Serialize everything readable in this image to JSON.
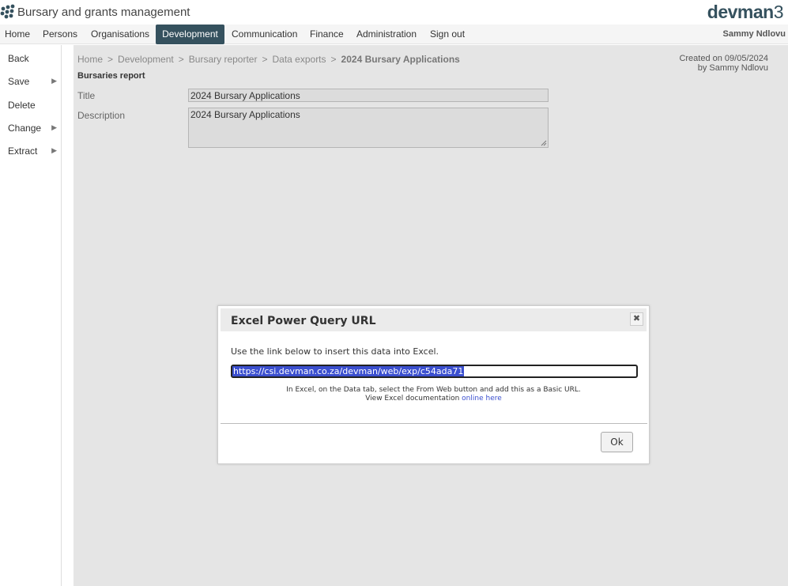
{
  "app": {
    "title": "Bursary and grants management",
    "brand_main": "devman",
    "brand_suffix": "3"
  },
  "nav": {
    "items": [
      "Home",
      "Persons",
      "Organisations",
      "Development",
      "Communication",
      "Finance",
      "Administration",
      "Sign out"
    ],
    "active": "Development",
    "user": "Sammy Ndlovu"
  },
  "sidebar": {
    "items": [
      {
        "label": "Back",
        "has_submenu": false
      },
      {
        "label": "Save",
        "has_submenu": true
      },
      {
        "label": "Delete",
        "has_submenu": false
      },
      {
        "label": "Change",
        "has_submenu": true
      },
      {
        "label": "Extract",
        "has_submenu": true
      }
    ]
  },
  "breadcrumb": {
    "items": [
      "Home",
      "Development",
      "Bursary reporter",
      "Data exports"
    ],
    "current": "2024 Bursary Applications",
    "separator": ">"
  },
  "meta": {
    "created_line1": "Created on 09/05/2024",
    "created_line2": "by Sammy Ndlovu"
  },
  "form": {
    "section_title": "Bursaries report",
    "title_label": "Title",
    "title_value": "2024 Bursary Applications",
    "description_label": "Description",
    "description_value": "2024 Bursary Applications"
  },
  "modal": {
    "title": "Excel Power Query URL",
    "close_icon": "close-icon",
    "intro": "Use the link below to insert this data into Excel.",
    "url": "https://csi.devman.co.za/devman/web/exp/c54ada71",
    "hint_line1": "In Excel, on the Data tab, select the From Web button and add this as a Basic URL.",
    "hint_line2_prefix": "View Excel documentation",
    "hint_link": "online here",
    "ok_label": "Ok"
  },
  "colors": {
    "accent": "#35515e",
    "selection": "#3b4fcf",
    "main_bg": "#e5e5e5"
  }
}
